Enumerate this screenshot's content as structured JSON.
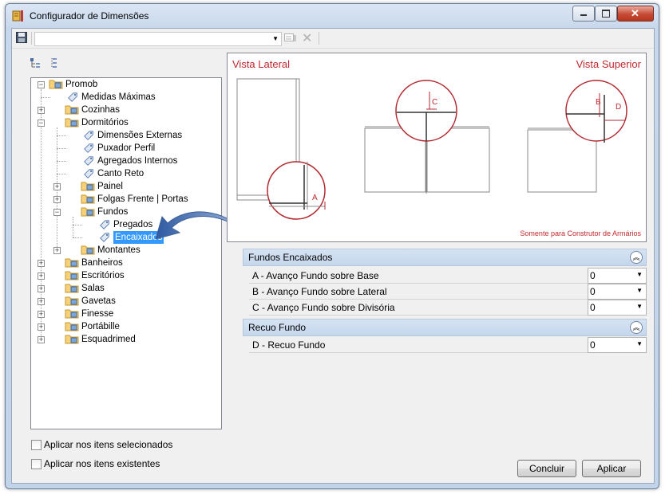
{
  "window": {
    "title": "Configurador de Dimensões",
    "icon": "ruler-app-icon"
  },
  "toolbar": {
    "combo_value": "",
    "icons": [
      "save-icon",
      "combo-arrow-icon",
      "properties-icon",
      "delete-icon"
    ]
  },
  "tree_tools": [
    "expand-all-icon",
    "collapse-all-icon"
  ],
  "tree": {
    "root": "Promob",
    "items": [
      {
        "label": "Medidas Máximas",
        "type": "tag",
        "depth": 1
      },
      {
        "label": "Cozinhas",
        "type": "folder",
        "depth": 1,
        "expander": "+"
      },
      {
        "label": "Dormitórios",
        "type": "folder",
        "depth": 1,
        "expander": "-"
      },
      {
        "label": "Dimensões Externas",
        "type": "tag",
        "depth": 2
      },
      {
        "label": "Puxador Perfil",
        "type": "tag",
        "depth": 2
      },
      {
        "label": "Agregados Internos",
        "type": "tag",
        "depth": 2
      },
      {
        "label": "Canto Reto",
        "type": "tag",
        "depth": 2
      },
      {
        "label": "Painel",
        "type": "folder",
        "depth": 2,
        "expander": "+"
      },
      {
        "label": "Folgas Frente | Portas",
        "type": "folder",
        "depth": 2,
        "expander": "+"
      },
      {
        "label": "Fundos",
        "type": "folder",
        "depth": 2,
        "expander": "-"
      },
      {
        "label": "Pregados",
        "type": "tag",
        "depth": 3
      },
      {
        "label": "Encaixados",
        "type": "tag",
        "depth": 3,
        "selected": true
      },
      {
        "label": "Montantes",
        "type": "folder",
        "depth": 2,
        "expander": "+"
      },
      {
        "label": "Banheiros",
        "type": "folder",
        "depth": 1,
        "expander": "+"
      },
      {
        "label": "Escritórios",
        "type": "folder",
        "depth": 1,
        "expander": "+"
      },
      {
        "label": "Salas",
        "type": "folder",
        "depth": 1,
        "expander": "+"
      },
      {
        "label": "Gavetas",
        "type": "folder",
        "depth": 1,
        "expander": "+"
      },
      {
        "label": "Finesse",
        "type": "folder",
        "depth": 1,
        "expander": "+"
      },
      {
        "label": "Portábille",
        "type": "folder",
        "depth": 1,
        "expander": "+"
      },
      {
        "label": "Esquadrimed",
        "type": "folder",
        "depth": 1,
        "expander": "+"
      }
    ]
  },
  "preview": {
    "left_title": "Vista Lateral",
    "right_title": "Vista Superior",
    "footnote": "Somente para Construtor de Armários",
    "markers": {
      "a": "A",
      "b": "B",
      "c": "C",
      "d": "D"
    },
    "accent_color": "#c0282d"
  },
  "sections": [
    {
      "title": "Fundos Encaixados",
      "collapse_icon": "collapse-up-icon",
      "rows": [
        {
          "name": "A - Avanço Fundo sobre Base",
          "value": "0"
        },
        {
          "name": "B - Avanço Fundo sobre Lateral",
          "value": "0"
        },
        {
          "name": "C - Avanço Fundo sobre Divisória",
          "value": "0"
        }
      ]
    },
    {
      "title": "Recuo Fundo",
      "collapse_icon": "collapse-up-icon",
      "rows": [
        {
          "name": "D - Recuo Fundo",
          "value": "0"
        }
      ]
    }
  ],
  "options": {
    "apply_selected": "Aplicar nos itens selecionados",
    "apply_existing": "Aplicar nos itens existentes"
  },
  "buttons": {
    "finish": "Concluir",
    "apply": "Aplicar"
  }
}
